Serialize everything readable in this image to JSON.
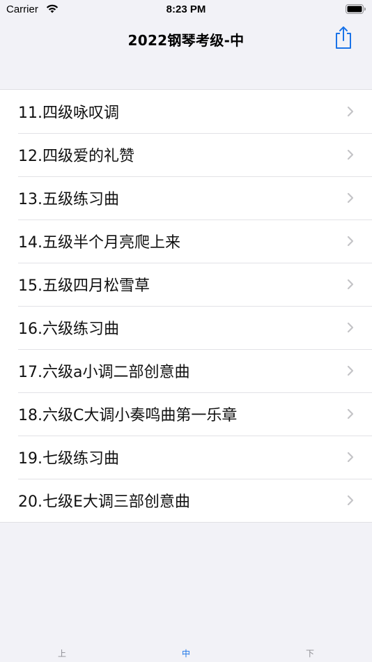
{
  "status_bar": {
    "carrier": "Carrier",
    "time": "8:23 PM"
  },
  "nav": {
    "title": "2022钢琴考级-中",
    "share_icon": "share-icon",
    "accent_color": "#1a73e8"
  },
  "list": {
    "items": [
      {
        "label": "11.四级咏叹调"
      },
      {
        "label": "12.四级爱的礼赞"
      },
      {
        "label": "13.五级练习曲"
      },
      {
        "label": "14.五级半个月亮爬上来"
      },
      {
        "label": "15.五级四月松雪草"
      },
      {
        "label": "16.六级练习曲"
      },
      {
        "label": "17.六级a小调二部创意曲"
      },
      {
        "label": "18.六级C大调小奏鸣曲第一乐章"
      },
      {
        "label": "19.七级练习曲"
      },
      {
        "label": "20.七级E大调三部创意曲"
      }
    ]
  },
  "tabs": [
    {
      "label": "上",
      "active": false
    },
    {
      "label": "中",
      "active": true
    },
    {
      "label": "下",
      "active": false
    }
  ]
}
